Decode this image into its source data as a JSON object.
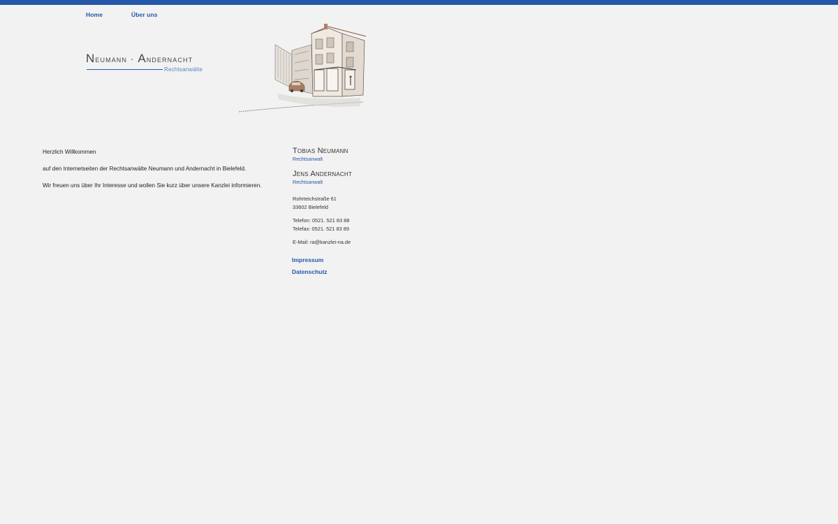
{
  "nav": {
    "home_label": "Home",
    "about_label": "Über uns"
  },
  "logo": {
    "first_initial": "N",
    "first_rest": "eumann",
    "separator": "·",
    "second_initial": "A",
    "second_rest": "ndernacht",
    "subtitle": "Rechtsanwälte"
  },
  "welcome": {
    "greeting": "Herzlich Willkommen",
    "intro": "auf den Internetseiten der Rechtsanwälte Neumann und Andernacht in Bielefeld.",
    "closing": "Wir freuen uns über Ihr Interesse und wollen Sie kurz über unsere Kanzlei informieren."
  },
  "contact": {
    "lawyer1_name": "Tobias Neumann",
    "lawyer1_role": "Rechtsanwalt",
    "lawyer2_name": "Jens Andernacht",
    "lawyer2_role": "Rechtsanwalt",
    "street": "Rohrteichstraße 61",
    "city": "33602 Bielefeld",
    "phone": "Telefon: 0521. 521 83 88",
    "fax": "Telefax: 0521. 521 83 89",
    "email": "E-Mail: ra@kanzlei-na.de"
  },
  "footer_links": {
    "impressum": "Impressum",
    "datenschutz": "Datenschutz"
  },
  "colors": {
    "accent": "#2457a8",
    "background": "#f2f2f2"
  },
  "icons": {
    "sketch": "street-corner-building-sketch"
  }
}
